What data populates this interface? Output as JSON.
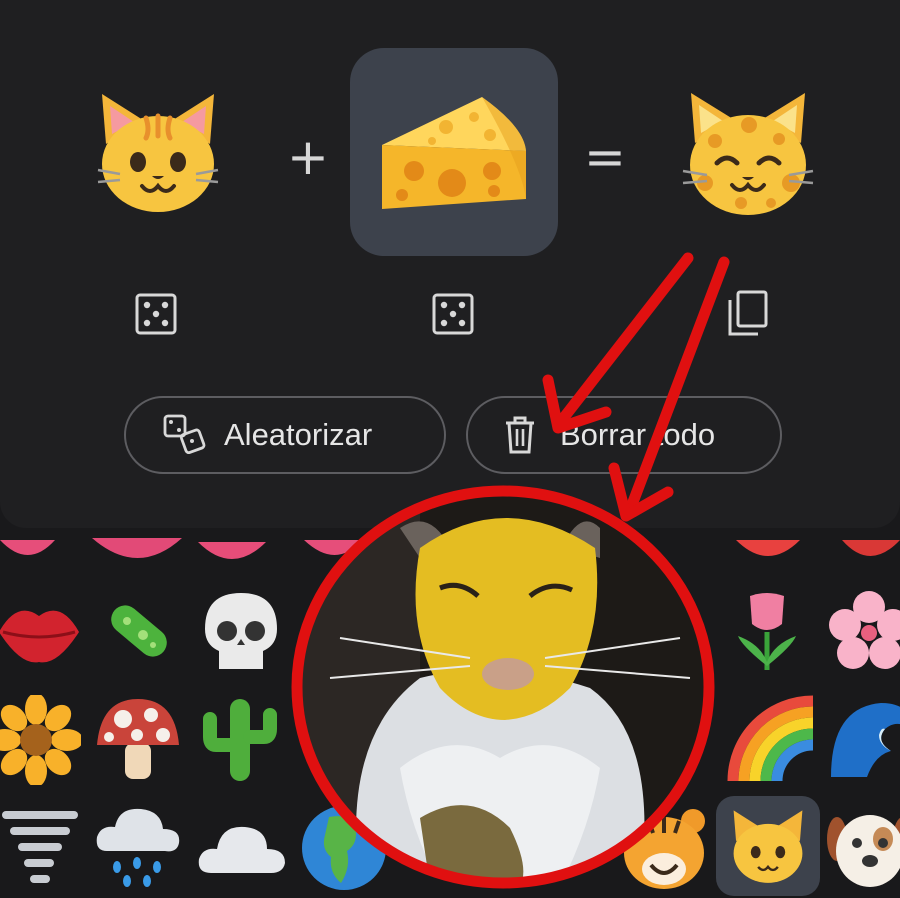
{
  "mixer": {
    "left_emoji": "cat-face",
    "plus": "+",
    "right_emoji": "cheese-wedge",
    "equals": "=",
    "result_emoji": "cheese-cat"
  },
  "actions": {
    "randomize_label": "Aleatorizar",
    "clear_label": "Borrar todo"
  },
  "colors": {
    "panel": "#1f1f21",
    "selected_slot": "#3d424c",
    "annotation_red": "#e01010",
    "pill_border": "#5d5d61"
  },
  "grid_emojis": [
    "lips-icon",
    "microbe-icon",
    "skull-icon",
    "tulip-icon",
    "cherry-blossom-icon",
    "sunflower-icon",
    "mushroom-icon",
    "cactus-icon",
    "rainbow-icon",
    "wave-icon",
    "tornado-icon",
    "rain-cloud-icon",
    "cloud-icon",
    "globe-icon",
    "tiger-icon",
    "cat-face-icon",
    "dog-face-icon"
  ]
}
